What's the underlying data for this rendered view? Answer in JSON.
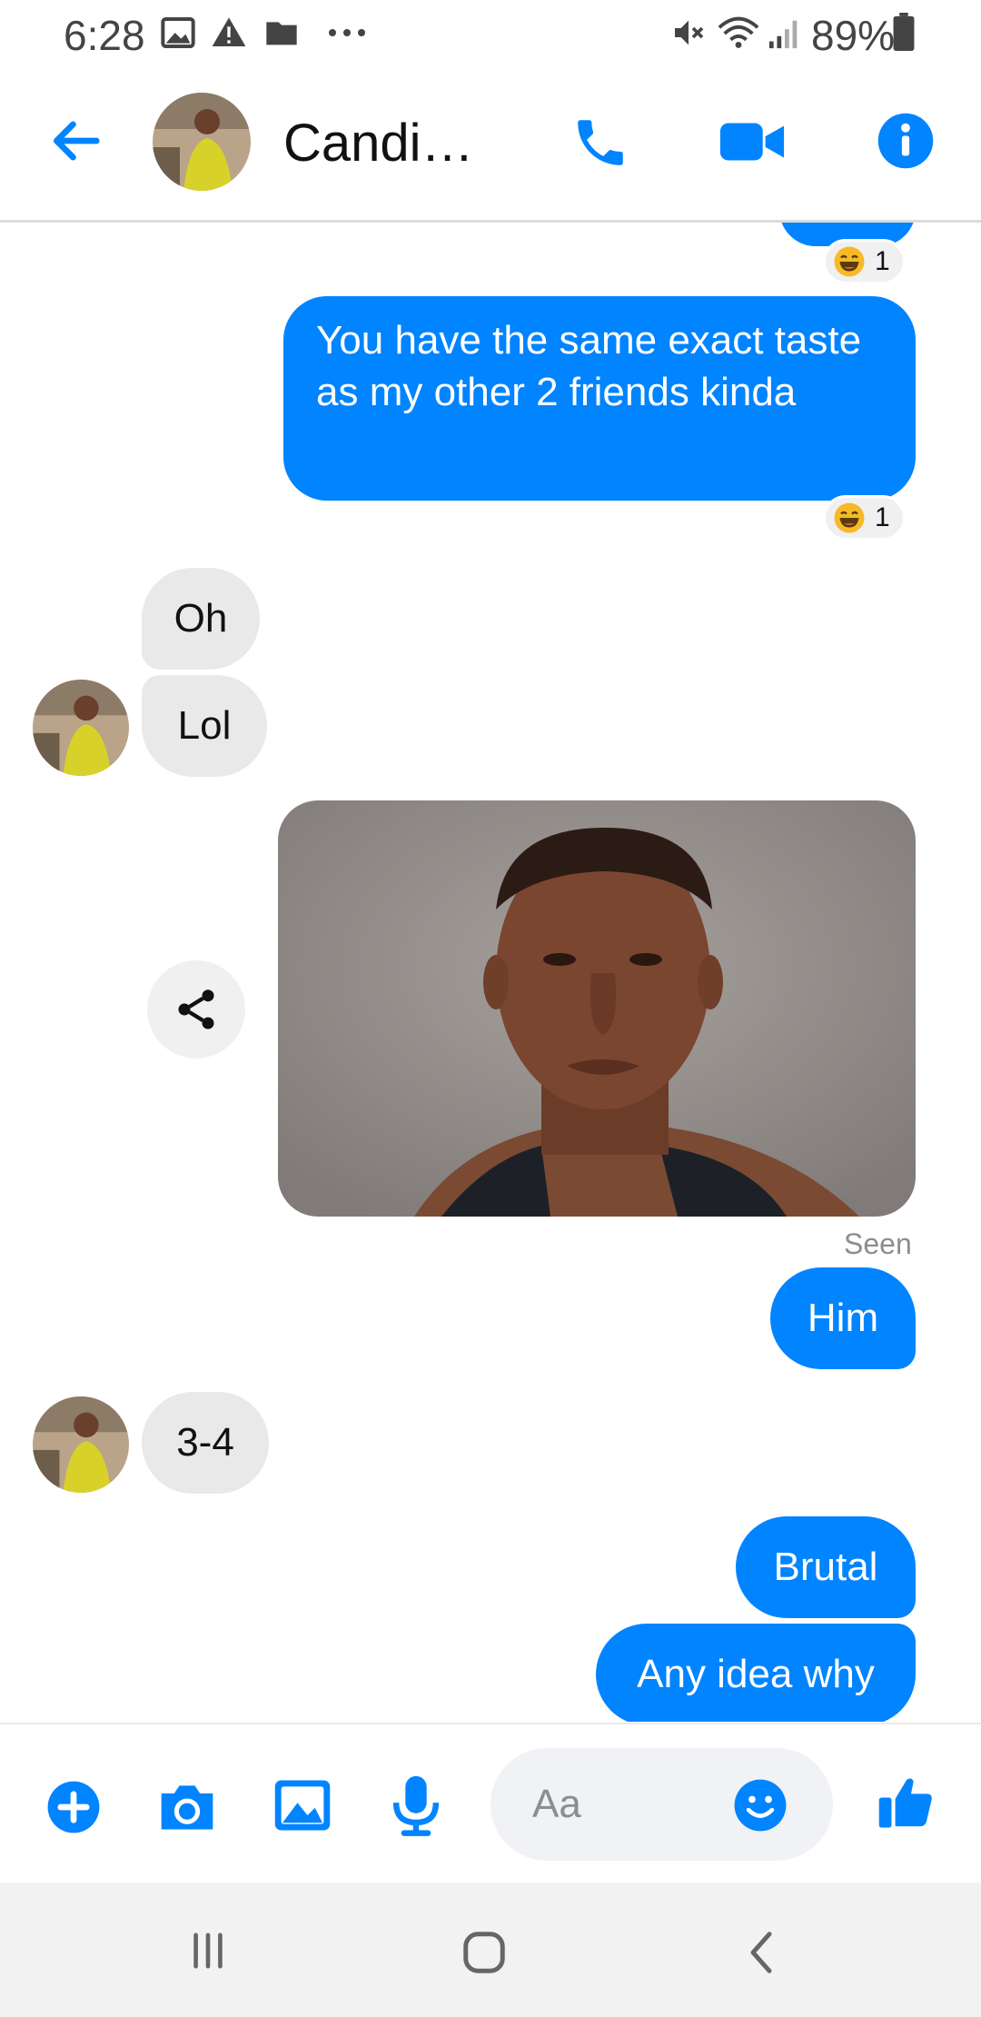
{
  "status_bar": {
    "time": "6:28",
    "battery": "89%",
    "icons": [
      "image-icon",
      "alert-icon",
      "folder-icon",
      "more-icon",
      "mute-icon",
      "wifi-icon",
      "signal-icon",
      "battery-icon"
    ]
  },
  "header": {
    "contact_name": "Candi…",
    "actions": [
      "back-icon",
      "phone-icon",
      "video-icon",
      "info-icon"
    ]
  },
  "messages": [
    {
      "from": "me",
      "text": "You have the same exact taste as my other 2 friends kinda",
      "reaction": {
        "emoji": "laugh-emoji",
        "count": "1"
      }
    },
    {
      "from": "them",
      "text": "Oh"
    },
    {
      "from": "them",
      "text": "Lol"
    },
    {
      "from": "me",
      "type": "photo",
      "subject": "portrait photo"
    },
    {
      "from": "me",
      "text": "Him"
    },
    {
      "from": "them",
      "text": "3-4"
    },
    {
      "from": "me",
      "text": "Brutal"
    },
    {
      "from": "me",
      "text": "Any idea why"
    }
  ],
  "top_partial_reaction": {
    "emoji": "laugh-emoji",
    "count": "1"
  },
  "seen_label": "Seen",
  "composer": {
    "placeholder": "Aa",
    "icons": [
      "plus-icon",
      "camera-icon",
      "gallery-icon",
      "microphone-icon",
      "emoji-icon",
      "thumbs-up-icon"
    ]
  },
  "colors": {
    "accent": "#0084ff",
    "incoming_bubble": "#e9e9ea",
    "navbar": "#f2f2f2"
  }
}
